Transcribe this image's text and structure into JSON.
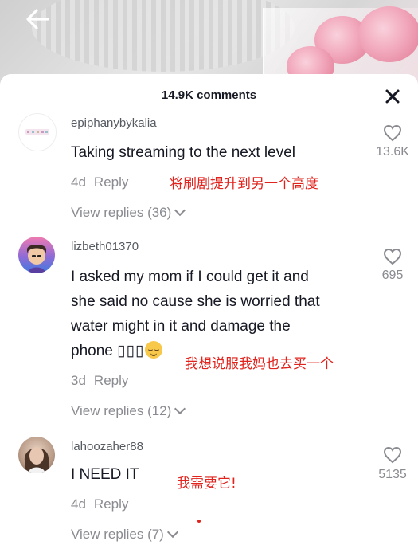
{
  "header": {
    "comment_count": "14.9K comments"
  },
  "comments": [
    {
      "username": "epiphanybykalia",
      "text": "Taking streaming to the next level",
      "age": "4d",
      "reply_label": "Reply",
      "view_replies": "View replies (36)",
      "likes": "13.6K",
      "annotation": "将刷剧提升到另一个高度"
    },
    {
      "username": "lizbeth01370",
      "text_lines": [
        "I asked my mom if I could get it and",
        "she said no cause she is worried that",
        "water might in it and damage the"
      ],
      "text_last": "phone ",
      "text_boxes": "▯▯▯",
      "age": "3d",
      "reply_label": "Reply",
      "view_replies": "View replies (12)",
      "likes": "695",
      "annotation": "我想说服我妈也去买一个"
    },
    {
      "username": "lahoozaher88",
      "text": "I NEED IT",
      "age": "4d",
      "reply_label": "Reply",
      "view_replies": "View replies (7)",
      "likes": "5135",
      "annotation": "我需要它!"
    }
  ],
  "icons": {
    "back": "arrow-left-icon",
    "close": "close-icon",
    "like": "heart-outline-icon",
    "expand": "chevron-down-icon",
    "emoji": "relieved-face-emoji"
  },
  "colors": {
    "annotation": "#e0231d",
    "text": "#161823",
    "muted": "#8a8b91"
  }
}
